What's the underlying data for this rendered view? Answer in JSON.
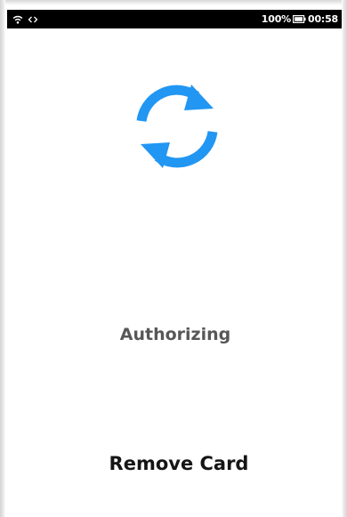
{
  "status_bar": {
    "battery_percent": "100%",
    "time": "00:58",
    "icons": [
      "wifi-icon",
      "data-transfer-icon",
      "battery-icon"
    ]
  },
  "main": {
    "progress_icon": "sync-icon",
    "status_message": "Authorizing",
    "instruction": "Remove Card"
  },
  "colors": {
    "accent": "#2196F3",
    "status_bar_bg": "#000000",
    "message_text": "#575757",
    "instruction_text": "#151515"
  }
}
